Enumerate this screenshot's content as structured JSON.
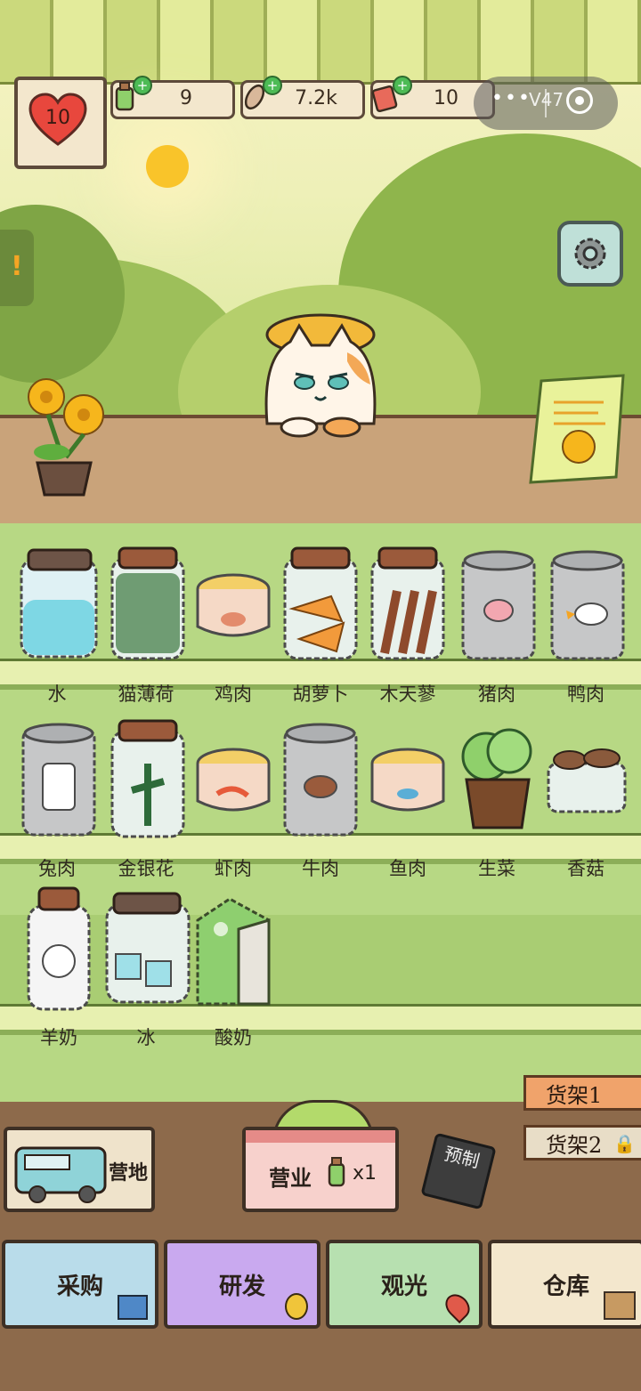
{
  "hud": {
    "hearts": "10",
    "resources": [
      {
        "name": "bottle-currency",
        "value": "9"
      },
      {
        "name": "fish-currency",
        "value": "7.2k"
      },
      {
        "name": "ticket-currency",
        "value": "10"
      }
    ],
    "version": "V47"
  },
  "shelf_rows": [
    [
      "水",
      "猫薄荷",
      "鸡肉",
      "胡萝卜",
      "木天蓼",
      "猪肉",
      "鸭肉"
    ],
    [
      "兔肉",
      "金银花",
      "虾肉",
      "牛肉",
      "鱼肉",
      "生菜",
      "香菇"
    ],
    [
      "羊奶",
      "冰",
      "酸奶"
    ]
  ],
  "actions": {
    "camp_label": "营地",
    "business_label": "营业",
    "business_count": "x1",
    "preorder_label": "预制",
    "shelf1": "货架1",
    "shelf2": "货架2"
  },
  "tabs": [
    "采购",
    "研发",
    "观光",
    "仓库"
  ],
  "colors": {
    "accent": "#f0a36b",
    "tab_buy": "#b9dcea",
    "tab_research": "#c9a9ef",
    "tab_tour": "#b7e0b0",
    "tab_storage": "#f3e7cd"
  }
}
